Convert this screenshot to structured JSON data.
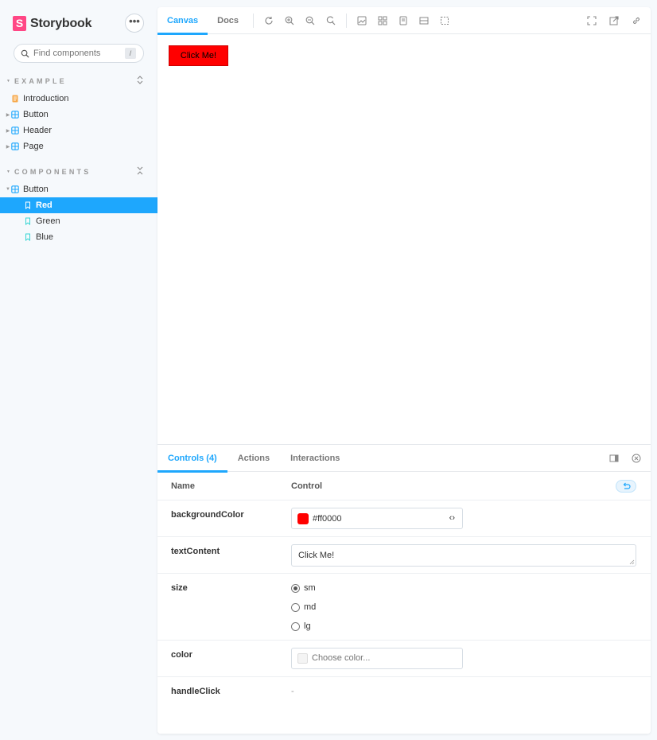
{
  "sidebar": {
    "brand": {
      "logo": "S",
      "name": "Storybook"
    },
    "menu_label": "•••",
    "search": {
      "placeholder": "Find components",
      "shortcut": "/"
    },
    "sections": [
      {
        "title": "EXAMPLE",
        "items": [
          {
            "label": "Introduction",
            "icon": "document-icon",
            "expandable": false
          },
          {
            "label": "Button",
            "icon": "component-icon",
            "expandable": true
          },
          {
            "label": "Header",
            "icon": "component-icon",
            "expandable": true
          },
          {
            "label": "Page",
            "icon": "component-icon",
            "expandable": true
          }
        ]
      },
      {
        "title": "COMPONENTS",
        "items": [
          {
            "label": "Button",
            "icon": "component-icon",
            "expandable": true,
            "expanded": true
          },
          {
            "label": "Red",
            "icon": "bookmark-icon",
            "selected": true
          },
          {
            "label": "Green",
            "icon": "bookmark-icon"
          },
          {
            "label": "Blue",
            "icon": "bookmark-icon"
          }
        ]
      }
    ]
  },
  "toolbar": {
    "tabs": [
      "Canvas",
      "Docs"
    ],
    "active_tab": "Canvas",
    "tools": [
      "reload-icon",
      "zoom-in-icon",
      "zoom-out-icon",
      "zoom-reset-icon",
      "background-icon",
      "grid-icon",
      "viewport-icon",
      "measure-icon",
      "outline-icon"
    ],
    "right_tools": [
      "fullscreen-icon",
      "open-new-tab-icon",
      "copy-link-icon"
    ]
  },
  "canvas": {
    "button_label": "Click Me!",
    "button_bg": "#ff0000"
  },
  "panel": {
    "tabs": [
      "Controls (4)",
      "Actions",
      "Interactions"
    ],
    "active_tab": "Controls (4)",
    "header": {
      "name": "Name",
      "control": "Control"
    },
    "rows": {
      "backgroundColor": {
        "name": "backgroundColor",
        "value": "#ff0000",
        "swatch": "#ff0000",
        "toggle": "‹›"
      },
      "textContent": {
        "name": "textContent",
        "value": "Click Me!"
      },
      "size": {
        "name": "size",
        "options": [
          "sm",
          "md",
          "lg"
        ],
        "selected": "sm"
      },
      "color": {
        "name": "color",
        "placeholder": "Choose color..."
      },
      "handleClick": {
        "name": "handleClick",
        "value": "-"
      }
    }
  },
  "colors": {
    "accent": "#1ea7fd",
    "brand": "#ff4785",
    "background": "#f6f9fc"
  }
}
